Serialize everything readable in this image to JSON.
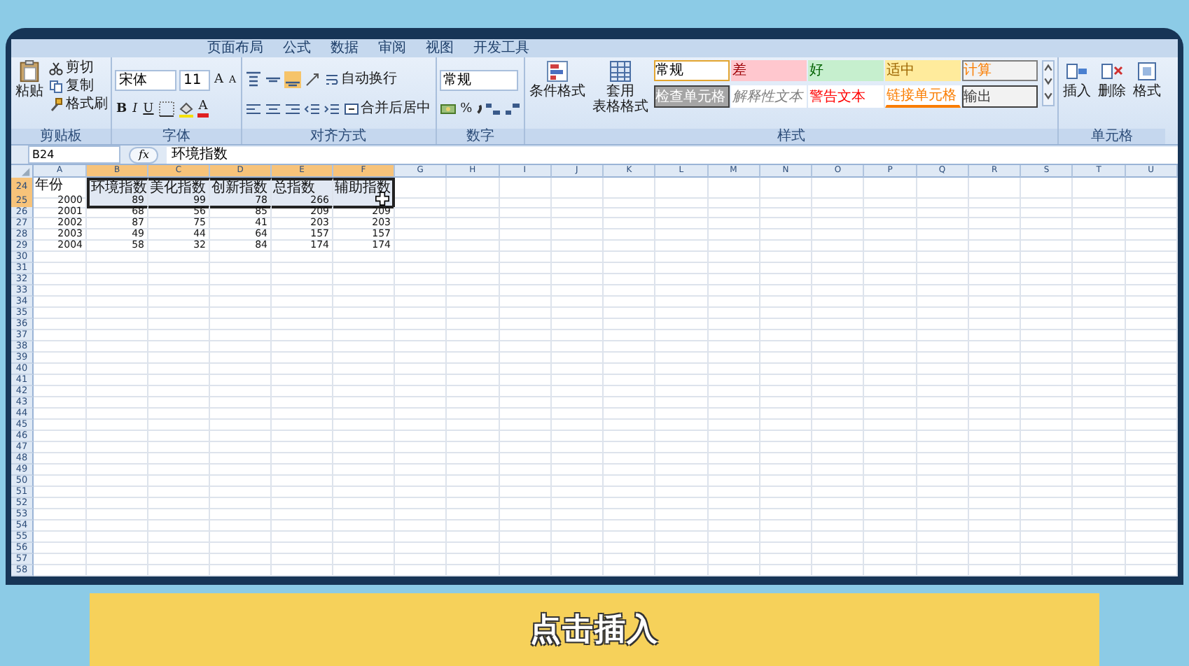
{
  "ribbon_tabs": [
    "页面布局",
    "公式",
    "数据",
    "审阅",
    "视图",
    "开发工具"
  ],
  "clipboard": {
    "paste": "粘贴",
    "cut": "剪切",
    "copy": "复制",
    "format_painter": "格式刷",
    "group": "剪贴板"
  },
  "font": {
    "name": "宋体",
    "size": "11",
    "grow": "A",
    "shrink": "A",
    "bold": "B",
    "italic": "I",
    "underline": "U",
    "font_color": "A",
    "group": "字体"
  },
  "alignment": {
    "wrap": "自动换行",
    "merge": "合并后居中",
    "group": "对齐方式"
  },
  "number": {
    "format": "常规",
    "percent": "%",
    "group": "数字"
  },
  "styles": {
    "conditional": "条件格式",
    "table": [
      "套用",
      "表格格式"
    ],
    "group": "样式",
    "cells": [
      {
        "label": "常规",
        "kind": "normal"
      },
      {
        "label": "差",
        "kind": "bad"
      },
      {
        "label": "好",
        "kind": "good"
      },
      {
        "label": "适中",
        "kind": "neutral"
      },
      {
        "label": "计算",
        "kind": "calc"
      },
      {
        "label": "检查单元格",
        "kind": "check"
      },
      {
        "label": "解释性文本",
        "kind": "explanatory"
      },
      {
        "label": "警告文本",
        "kind": "warning"
      },
      {
        "label": "链接单元格",
        "kind": "linked"
      },
      {
        "label": "输出",
        "kind": "output"
      }
    ]
  },
  "cells_group": {
    "insert": "插入",
    "delete": "删除",
    "format": "格式",
    "group": "单元格"
  },
  "formula_bar": {
    "name_box": "B24",
    "fx": "fx",
    "formula": "环境指数"
  },
  "sheet": {
    "columns": [
      {
        "label": "A",
        "selected": false
      },
      {
        "label": "B",
        "selected": true
      },
      {
        "label": "C",
        "selected": true
      },
      {
        "label": "D",
        "selected": true
      },
      {
        "label": "E",
        "selected": true
      },
      {
        "label": "F",
        "selected": true
      },
      {
        "label": "G",
        "selected": false
      },
      {
        "label": "H",
        "selected": false
      },
      {
        "label": "I",
        "selected": false
      },
      {
        "label": "J",
        "selected": false
      },
      {
        "label": "K",
        "selected": false
      },
      {
        "label": "L",
        "selected": false
      },
      {
        "label": "M",
        "selected": false
      },
      {
        "label": "N",
        "selected": false
      },
      {
        "label": "O",
        "selected": false
      },
      {
        "label": "P",
        "selected": false
      },
      {
        "label": "Q",
        "selected": false
      },
      {
        "label": "R",
        "selected": false
      },
      {
        "label": "S",
        "selected": false
      },
      {
        "label": "T",
        "selected": false
      },
      {
        "label": "U",
        "selected": false
      }
    ],
    "rows": [
      {
        "num": "24",
        "selected": true,
        "kind": "header",
        "cells": [
          {
            "text": "年份",
            "selected": false
          },
          {
            "text": "环境指数",
            "selected": true
          },
          {
            "text": "美化指数",
            "selected": true
          },
          {
            "text": "创新指数",
            "selected": true
          },
          {
            "text": "总指数",
            "selected": true
          },
          {
            "text": "辅助指数",
            "selected": true
          }
        ]
      },
      {
        "num": "25",
        "selected": true,
        "kind": "data",
        "cells": [
          {
            "text": "2000",
            "selected": false
          },
          {
            "text": "89",
            "selected": true
          },
          {
            "text": "99",
            "selected": true
          },
          {
            "text": "78",
            "selected": true
          },
          {
            "text": "266",
            "selected": true
          },
          {
            "selected": true
          }
        ]
      },
      {
        "num": "26",
        "selected": false,
        "kind": "data",
        "cells": [
          {
            "text": "2001",
            "selected": false
          },
          {
            "text": "68",
            "selected": false
          },
          {
            "text": "56",
            "selected": false
          },
          {
            "text": "85",
            "selected": false
          },
          {
            "text": "209",
            "selected": false
          },
          {
            "text": "209",
            "selected": false
          }
        ]
      },
      {
        "num": "27",
        "selected": false,
        "kind": "data",
        "cells": [
          {
            "text": "2002",
            "selected": false
          },
          {
            "text": "87",
            "selected": false
          },
          {
            "text": "75",
            "selected": false
          },
          {
            "text": "41",
            "selected": false
          },
          {
            "text": "203",
            "selected": false
          },
          {
            "text": "203",
            "selected": false
          }
        ]
      },
      {
        "num": "28",
        "selected": false,
        "kind": "data",
        "cells": [
          {
            "text": "2003",
            "selected": false
          },
          {
            "text": "49",
            "selected": false
          },
          {
            "text": "44",
            "selected": false
          },
          {
            "text": "64",
            "selected": false
          },
          {
            "text": "157",
            "selected": false
          },
          {
            "text": "157",
            "selected": false
          }
        ]
      },
      {
        "num": "29",
        "selected": false,
        "kind": "data",
        "cells": [
          {
            "text": "2004",
            "selected": false
          },
          {
            "text": "58",
            "selected": false
          },
          {
            "text": "32",
            "selected": false
          },
          {
            "text": "84",
            "selected": false
          },
          {
            "text": "174",
            "selected": false
          },
          {
            "text": "174",
            "selected": false
          }
        ]
      },
      {
        "num": "30",
        "selected": false
      },
      {
        "num": "31",
        "selected": false
      },
      {
        "num": "32",
        "selected": false
      },
      {
        "num": "33",
        "selected": false
      },
      {
        "num": "34",
        "selected": false
      },
      {
        "num": "35",
        "selected": false
      },
      {
        "num": "36",
        "selected": false
      },
      {
        "num": "37",
        "selected": false
      },
      {
        "num": "38",
        "selected": false
      },
      {
        "num": "39",
        "selected": false
      },
      {
        "num": "40",
        "selected": false
      },
      {
        "num": "41",
        "selected": false
      },
      {
        "num": "42",
        "selected": false
      },
      {
        "num": "43",
        "selected": false
      },
      {
        "num": "44",
        "selected": false
      },
      {
        "num": "45",
        "selected": false
      },
      {
        "num": "46",
        "selected": false
      },
      {
        "num": "47",
        "selected": false
      },
      {
        "num": "48",
        "selected": false
      },
      {
        "num": "49",
        "selected": false
      },
      {
        "num": "50",
        "selected": false
      },
      {
        "num": "51",
        "selected": false
      },
      {
        "num": "52",
        "selected": false
      },
      {
        "num": "53",
        "selected": false
      },
      {
        "num": "54",
        "selected": false
      },
      {
        "num": "55",
        "selected": false
      },
      {
        "num": "56",
        "selected": false
      },
      {
        "num": "57",
        "selected": false
      },
      {
        "num": "58",
        "selected": false
      }
    ]
  },
  "caption": "点击插入"
}
